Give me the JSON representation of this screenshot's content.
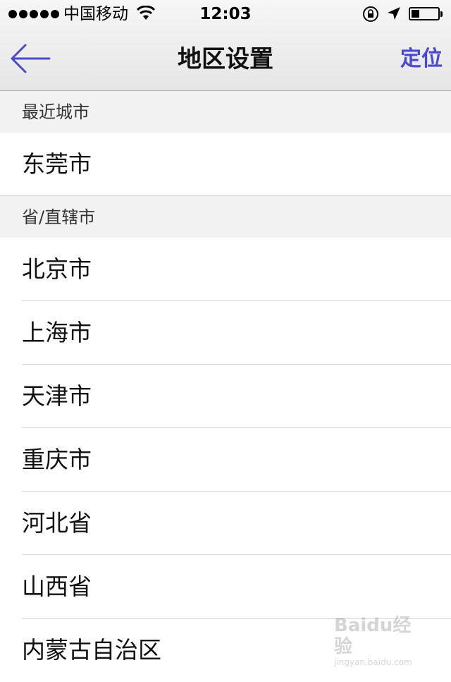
{
  "status_bar": {
    "carrier": "中国移动",
    "time": "12:03",
    "battery_level": 0.3,
    "icons": [
      "signal-dots",
      "wifi-icon",
      "rotation-lock-icon",
      "location-arrow-icon",
      "battery-icon"
    ]
  },
  "nav": {
    "back_icon": "arrow-left-icon",
    "title": "地区设置",
    "locate_label": "定位",
    "accent_color": "#4a4ad0"
  },
  "sections": {
    "recent": {
      "header": "最近城市",
      "items": [
        "东莞市"
      ]
    },
    "provinces": {
      "header": "省/直辖市",
      "items": [
        "北京市",
        "上海市",
        "天津市",
        "重庆市",
        "河北省",
        "山西省",
        "内蒙古自治区"
      ]
    }
  },
  "watermark": {
    "logo": "Baidu经验",
    "url": "jingyan.baidu.com"
  }
}
